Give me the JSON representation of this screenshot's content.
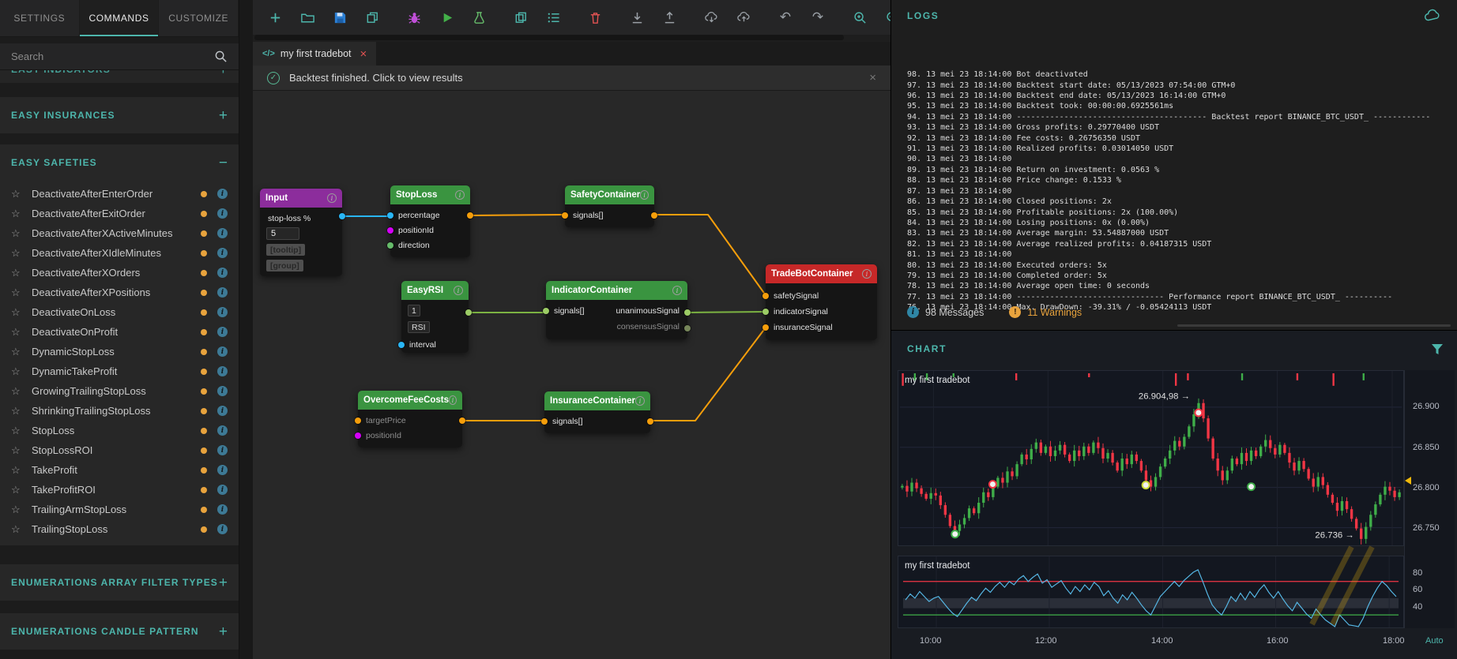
{
  "palette": {
    "accent": "#4db6ac",
    "orange": "#e8a33d",
    "red": "#e05252",
    "green": "#3a9440",
    "purple": "#8c2d9c",
    "cyan": "#29b6f6",
    "magenta": "#d500f9",
    "lime": "#9ccc65",
    "wire-orange": "#f59e0b",
    "wire-green": "#7cb342",
    "candle-up": "#3fae49",
    "candle-down": "#f23645",
    "rsi-line": "#56b8e6",
    "yellow": "#f0b90b"
  },
  "glyphs": {
    "close": "×",
    "check": "✓",
    "star": "☆",
    "plus": "+",
    "minus": "−",
    "info": "i",
    "warn": "!",
    "undo": "↶",
    "redo": "↷"
  },
  "topTabs": [
    {
      "label": "SETTINGS"
    },
    {
      "label": "COMMANDS"
    },
    {
      "label": "CUSTOMIZE"
    }
  ],
  "sidebar": {
    "search_placeholder": "Search",
    "clipped_section": "EASY INDICATORS",
    "insurances_label": "EASY INSURANCES",
    "safeties": {
      "label": "EASY SAFETIES",
      "items": [
        "DeactivateAfterEnterOrder",
        "DeactivateAfterExitOrder",
        "DeactivateAfterXActiveMinutes",
        "DeactivateAfterXIdleMinutes",
        "DeactivateAfterXOrders",
        "DeactivateAfterXPositions",
        "DeactivateOnLoss",
        "DeactivateOnProfit",
        "DynamicStopLoss",
        "DynamicTakeProfit",
        "GrowingTrailingStopLoss",
        "ShrinkingTrailingStopLoss",
        "StopLoss",
        "StopLossROI",
        "TakeProfit",
        "TakeProfitROI",
        "TrailingArmStopLoss",
        "TrailingStopLoss"
      ]
    },
    "enum_array_label": "ENUMERATIONS ARRAY FILTER TYPES",
    "enum_candle_label": "ENUMERATIONS CANDLE PATTERN"
  },
  "editor": {
    "tab": {
      "icon": "</>",
      "label": "my first tradebot"
    },
    "notification": "Backtest finished. Click to view results",
    "nodes": {
      "input": {
        "title": "Input",
        "field_label": "stop-loss %",
        "field_value": "5",
        "tooltip": "[tooltip]",
        "group": "[group]"
      },
      "stoploss": {
        "title": "StopLoss",
        "row1": "percentage",
        "row2": "positionId",
        "row3": "direction"
      },
      "safety": {
        "title": "SafetyContainer",
        "row1": "signals[]"
      },
      "easyrsi": {
        "title": "EasyRSI",
        "value": "1",
        "type": "RSI",
        "row1": "interval"
      },
      "indicator": {
        "title": "IndicatorContainer",
        "in1": "signals[]",
        "out1": "unanimousSignal",
        "out2": "consensusSignal"
      },
      "fees": {
        "title": "OvercomeFeeCosts",
        "row1": "targetPrice",
        "row2": "positionId"
      },
      "insurance": {
        "title": "InsuranceContainer",
        "row1": "signals[]"
      },
      "tradebot": {
        "title": "TradeBotContainer",
        "row1": "safetySignal",
        "row2": "indicatorSignal",
        "row3": "insuranceSignal"
      }
    }
  },
  "logs": {
    "title": "LOGS",
    "lines": [
      "98. 13 mei 23 18:14:00 Bot deactivated",
      "97. 13 mei 23 18:14:00 Backtest start date: 05/13/2023 07:54:00 GTM+0",
      "96. 13 mei 23 18:14:00 Backtest end date: 05/13/2023 16:14:00 GTM+0",
      "95. 13 mei 23 18:14:00 Backtest took: 00:00:00.6925561ms",
      "94. 13 mei 23 18:14:00 ---------------------------------------- Backtest report BINANCE_BTC_USDT_ ------------",
      "93. 13 mei 23 18:14:00 Gross profits: 0.29770400 USDT",
      "92. 13 mei 23 18:14:00 Fee costs: 0.26756350 USDT",
      "91. 13 mei 23 18:14:00 Realized profits: 0.03014050 USDT",
      "90. 13 mei 23 18:14:00",
      "89. 13 mei 23 18:14:00 Return on investment: 0.0563 %",
      "88. 13 mei 23 18:14:00 Price change: 0.1533 %",
      "87. 13 mei 23 18:14:00",
      "86. 13 mei 23 18:14:00 Closed positions: 2x",
      "85. 13 mei 23 18:14:00 Profitable positions: 2x (100.00%)",
      "84. 13 mei 23 18:14:00 Losing positions: 0x (0.00%)",
      "83. 13 mei 23 18:14:00 Average margin: 53.54887000 USDT",
      "82. 13 mei 23 18:14:00 Average realized profits: 0.04187315 USDT",
      "81. 13 mei 23 18:14:00",
      "80. 13 mei 23 18:14:00 Executed orders: 5x",
      "79. 13 mei 23 18:14:00 Completed order: 5x",
      "78. 13 mei 23 18:14:00 Average open time: 0 seconds",
      "77. 13 mei 23 18:14:00 ------------------------------- Performance report BINANCE_BTC_USDT_ ----------",
      "76. 13 mei 23 18:14:00 Max. DrawDown: -39.31% / -0.05424113 USDT"
    ],
    "messages": "98 Messages",
    "warnings": "11 Warnings"
  },
  "chart": {
    "title": "CHART",
    "watermark": "my first tradebot",
    "price_labels": [
      "26.900",
      "26.850",
      "26.800",
      "26.750"
    ],
    "rsi_labels": [
      "80",
      "60",
      "40"
    ],
    "time_labels": [
      "10:00",
      "12:00",
      "14:00",
      "16:00",
      "18:00"
    ],
    "auto_label": "Auto"
  },
  "chart_data": {
    "type": "candlestick",
    "symbol": "BINANCE_BTC_USDT",
    "price_min": 26.728,
    "price_max": 26.945,
    "open_first": 26.8,
    "closes": [
      26.802,
      26.795,
      26.806,
      26.799,
      26.792,
      26.786,
      26.793,
      26.79,
      26.778,
      26.766,
      26.752,
      26.746,
      26.754,
      26.762,
      26.774,
      26.768,
      26.781,
      26.794,
      26.788,
      26.801,
      26.812,
      26.806,
      26.82,
      26.814,
      26.829,
      26.841,
      26.835,
      26.848,
      26.856,
      26.843,
      26.851,
      26.839,
      26.846,
      26.853,
      26.841,
      26.833,
      26.846,
      26.839,
      26.851,
      26.843,
      26.856,
      26.849,
      26.836,
      26.843,
      26.831,
      26.821,
      26.836,
      26.829,
      26.841,
      26.833,
      26.821,
      26.809,
      26.801,
      26.813,
      26.826,
      26.836,
      26.846,
      26.858,
      26.851,
      26.863,
      26.876,
      26.891,
      26.905,
      26.886,
      26.861,
      26.836,
      26.821,
      26.809,
      26.821,
      26.836,
      26.829,
      26.843,
      26.833,
      26.846,
      26.839,
      26.851,
      26.859,
      26.849,
      26.841,
      26.853,
      26.843,
      26.831,
      26.821,
      26.833,
      26.823,
      26.811,
      26.801,
      26.813,
      26.803,
      26.791,
      26.781,
      26.771,
      26.783,
      26.773,
      26.761,
      26.749,
      26.736,
      26.751,
      26.766,
      26.779,
      26.791,
      26.801,
      26.796,
      26.788,
      26.794
    ],
    "grid_prices": [
      26.9,
      26.85,
      26.8,
      26.75
    ],
    "time_fracs": [
      0.067,
      0.295,
      0.524,
      0.752,
      0.981
    ],
    "current_price": 26.809,
    "markers": [
      {
        "x": 0.11,
        "price": 26.742,
        "c": "g"
      },
      {
        "x": 0.185,
        "price": 26.804,
        "c": "r"
      },
      {
        "x": 0.49,
        "price": 26.803,
        "c": "y"
      },
      {
        "x": 0.595,
        "price": 26.893,
        "c": "r"
      },
      {
        "x": 0.7,
        "price": 26.801,
        "c": "g"
      }
    ],
    "annotations": [
      {
        "text": "26.904,98 →",
        "x": 0.578,
        "price": 26.914
      },
      {
        "text": "26.736 →",
        "x": 0.905,
        "price": 26.741
      }
    ],
    "ticks": [
      {
        "x": 0.004,
        "c": "r",
        "h": 16
      },
      {
        "x": 0.028,
        "c": "g",
        "h": 9
      },
      {
        "x": 0.052,
        "c": "g",
        "h": 9
      },
      {
        "x": 0.105,
        "c": "g",
        "h": 5
      },
      {
        "x": 0.23,
        "c": "r",
        "h": 9
      },
      {
        "x": 0.375,
        "c": "r",
        "h": 5
      },
      {
        "x": 0.548,
        "c": "r",
        "h": 16
      },
      {
        "x": 0.572,
        "c": "r",
        "h": 9
      },
      {
        "x": 0.68,
        "c": "g",
        "h": 9
      },
      {
        "x": 0.79,
        "c": "r",
        "h": 9
      },
      {
        "x": 0.862,
        "c": "r",
        "h": 16
      },
      {
        "x": 0.922,
        "c": "g",
        "h": 9
      }
    ],
    "rsi": {
      "values": [
        48,
        55,
        50,
        58,
        52,
        46,
        50,
        52,
        45,
        38,
        32,
        28,
        36,
        44,
        51,
        47,
        55,
        62,
        57,
        64,
        69,
        63,
        70,
        66,
        73,
        77,
        70,
        75,
        79,
        68,
        72,
        63,
        67,
        71,
        62,
        55,
        64,
        58,
        66,
        60,
        69,
        64,
        53,
        59,
        50,
        44,
        54,
        48,
        57,
        50,
        42,
        35,
        30,
        41,
        52,
        58,
        64,
        70,
        64,
        71,
        76,
        81,
        84,
        70,
        55,
        42,
        35,
        30,
        40,
        52,
        46,
        56,
        48,
        58,
        51,
        60,
        66,
        57,
        50,
        58,
        49,
        41,
        35,
        45,
        38,
        31,
        26,
        37,
        30,
        24,
        20,
        16,
        30,
        24,
        18,
        17,
        16,
        26,
        40,
        52,
        62,
        70,
        65,
        58,
        52
      ],
      "min": 15,
      "max": 100,
      "upper": 70,
      "lower": 30,
      "band": [
        38,
        50
      ]
    }
  },
  "toolbar_icons": [
    "add",
    "open-file",
    "save",
    "copy-file",
    "debug",
    "run-backtest",
    "test",
    "duplicate",
    "list",
    "delete",
    "download",
    "upload",
    "cloud-download",
    "cloud-upload",
    "undo",
    "redo",
    "zoom-in",
    "zoom-out"
  ]
}
